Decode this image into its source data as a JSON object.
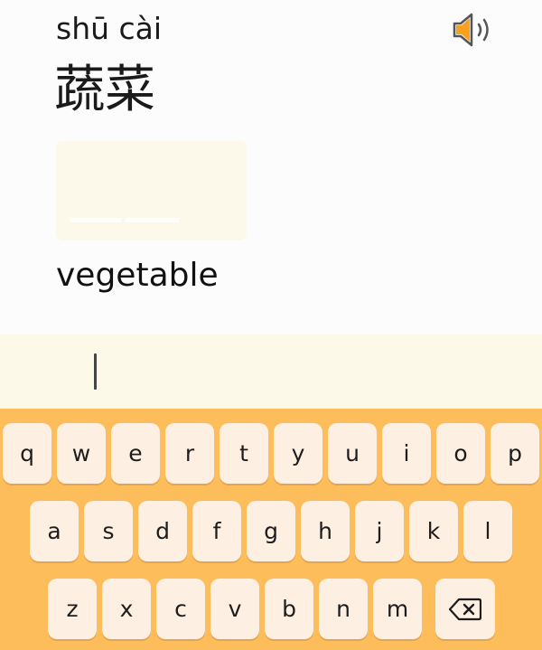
{
  "word": {
    "pinyin": "shū cài",
    "hanzi": "蔬菜",
    "meaning": "vegetable"
  },
  "icons": {
    "speaker": "speaker-icon",
    "backspace": "backspace-icon"
  },
  "colors": {
    "accent": "#f6a21e",
    "keyboard_bg": "#fdbd5b",
    "key_bg": "#fdefe2",
    "answer_bg": "#fdf9e8"
  },
  "answer": {
    "value": ""
  },
  "keyboard": {
    "row1": [
      "q",
      "w",
      "e",
      "r",
      "t",
      "y",
      "u",
      "i",
      "o",
      "p"
    ],
    "row2": [
      "a",
      "s",
      "d",
      "f",
      "g",
      "h",
      "j",
      "k",
      "l"
    ],
    "row3": [
      "z",
      "x",
      "c",
      "v",
      "b",
      "n",
      "m"
    ]
  }
}
